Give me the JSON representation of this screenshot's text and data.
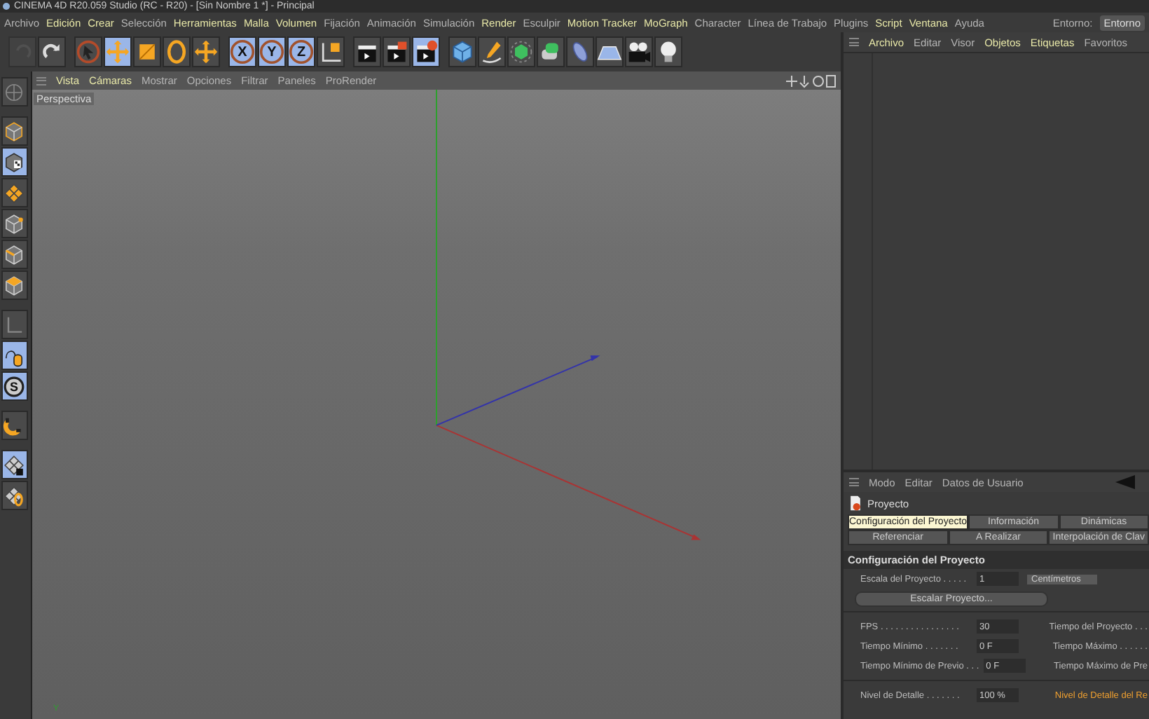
{
  "window": {
    "title": "CINEMA 4D R20.059 Studio (RC - R20) - [Sin Nombre 1 *] - Principal"
  },
  "menu": [
    {
      "label": "Archivo",
      "highlight": false
    },
    {
      "label": "Edición",
      "highlight": true
    },
    {
      "label": "Crear",
      "highlight": true
    },
    {
      "label": "Selección",
      "highlight": false
    },
    {
      "label": "Herramientas",
      "highlight": true
    },
    {
      "label": "Malla",
      "highlight": true
    },
    {
      "label": "Volumen",
      "highlight": true
    },
    {
      "label": "Fijación",
      "highlight": false
    },
    {
      "label": "Animación",
      "highlight": false
    },
    {
      "label": "Simulación",
      "highlight": false
    },
    {
      "label": "Render",
      "highlight": true
    },
    {
      "label": "Esculpir",
      "highlight": false
    },
    {
      "label": "Motion Tracker",
      "highlight": true
    },
    {
      "label": "MoGraph",
      "highlight": true
    },
    {
      "label": "Character",
      "highlight": false
    },
    {
      "label": "Línea de Trabajo",
      "highlight": false
    },
    {
      "label": "Plugins",
      "highlight": false
    },
    {
      "label": "Script",
      "highlight": true
    },
    {
      "label": "Ventana",
      "highlight": true
    },
    {
      "label": "Ayuda",
      "highlight": false
    }
  ],
  "layout": {
    "label": "Entorno:",
    "value": "Entorno"
  },
  "toolbar": [
    {
      "kind": "undo",
      "selected": false,
      "disabled": true
    },
    {
      "kind": "redo",
      "selected": false,
      "disabled": false
    },
    {
      "kind": "select",
      "selected": false,
      "disabled": false
    },
    {
      "kind": "move",
      "selected": true,
      "disabled": false
    },
    {
      "kind": "scale",
      "selected": false,
      "disabled": false
    },
    {
      "kind": "rotate",
      "selected": false,
      "disabled": false
    },
    {
      "kind": "cross",
      "selected": false,
      "disabled": false
    },
    {
      "kind": "axis",
      "label": "X",
      "selected": true,
      "disabled": false
    },
    {
      "kind": "axis",
      "label": "Y",
      "selected": true,
      "disabled": false
    },
    {
      "kind": "axis",
      "label": "Z",
      "selected": true,
      "disabled": false
    },
    {
      "kind": "coords",
      "selected": false,
      "disabled": false
    },
    {
      "kind": "clapper",
      "selected": false,
      "disabled": false
    },
    {
      "kind": "clapper-picture",
      "selected": false,
      "disabled": false
    },
    {
      "kind": "clapper-settings",
      "selected": true,
      "disabled": false
    },
    {
      "kind": "cube",
      "selected": false,
      "disabled": false
    },
    {
      "kind": "pen",
      "selected": false,
      "disabled": false
    },
    {
      "kind": "generator",
      "selected": false,
      "disabled": false
    },
    {
      "kind": "deformer",
      "selected": false,
      "disabled": false
    },
    {
      "kind": "capsule",
      "selected": false,
      "disabled": false
    },
    {
      "kind": "floor",
      "selected": false,
      "disabled": false
    },
    {
      "kind": "camera",
      "selected": false,
      "disabled": false
    },
    {
      "kind": "bulb",
      "selected": false,
      "disabled": false
    }
  ],
  "sidebar": [
    {
      "kind": "globe",
      "selected": false
    },
    {
      "kind": "cube",
      "selected": false
    },
    {
      "kind": "checker",
      "selected": true
    },
    {
      "kind": "grid",
      "selected": false
    },
    {
      "kind": "points",
      "selected": false
    },
    {
      "kind": "edges",
      "selected": false
    },
    {
      "kind": "polys",
      "selected": false
    },
    {
      "kind": "axes",
      "selected": false
    },
    {
      "kind": "mouse",
      "selected": true
    },
    {
      "kind": "snap",
      "label": "S",
      "selected": true
    },
    {
      "kind": "magnet",
      "selected": false
    },
    {
      "kind": "lock",
      "selected": true
    },
    {
      "kind": "sym",
      "selected": false
    }
  ],
  "viewport": {
    "menu": [
      {
        "label": "Vista",
        "highlight": true
      },
      {
        "label": "Cámaras",
        "highlight": true
      },
      {
        "label": "Mostrar",
        "highlight": false
      },
      {
        "label": "Opciones",
        "highlight": false
      },
      {
        "label": "Filtrar",
        "highlight": false
      },
      {
        "label": "Paneles",
        "highlight": false
      },
      {
        "label": "ProRender",
        "highlight": false
      }
    ],
    "camera": "Perspectiva",
    "axis_label": "Y"
  },
  "objects": {
    "menu": [
      {
        "label": "Archivo",
        "highlight": true
      },
      {
        "label": "Editar",
        "highlight": false
      },
      {
        "label": "Visor",
        "highlight": false
      },
      {
        "label": "Objetos",
        "highlight": true
      },
      {
        "label": "Etiquetas",
        "highlight": true
      },
      {
        "label": "Favoritos",
        "highlight": false
      }
    ]
  },
  "attributes": {
    "menu": [
      {
        "label": "Modo"
      },
      {
        "label": "Editar"
      },
      {
        "label": "Datos de Usuario"
      }
    ],
    "title": "Proyecto",
    "tabs": [
      [
        {
          "label": "Configuración del Proyecto",
          "selected": true
        },
        {
          "label": "Información",
          "selected": false
        },
        {
          "label": "Dinámicas",
          "selected": false
        }
      ],
      [
        {
          "label": "Referenciar",
          "selected": false
        },
        {
          "label": "A Realizar",
          "selected": false
        },
        {
          "label": "Interpolación de Clav",
          "selected": false
        }
      ]
    ],
    "section": "Configuración del Proyecto",
    "scale": {
      "label": "Escala del Proyecto . . . . .",
      "value": "1",
      "unit": "Centímetros"
    },
    "scale_button": "Escalar Proyecto...",
    "groups": [
      [
        {
          "label": "FPS . . . . . . . . . . . . . . . .",
          "value": "30",
          "right": "Tiempo del Proyecto . . .",
          "right_highlight": false
        },
        {
          "label": "Tiempo Mínimo . . . . . . .",
          "value": "0 F",
          "right": "Tiempo Máximo . . . . . .",
          "right_highlight": false
        },
        {
          "label": "Tiempo Mínimo de Previo . . .",
          "value": "0 F",
          "right": "Tiempo Máximo de Pre",
          "right_highlight": false
        }
      ],
      [
        {
          "label": "Nivel de Detalle . . . . . . .",
          "value": "100 %",
          "right": "Nivel de Detalle del Re",
          "right_highlight": true
        }
      ]
    ]
  }
}
